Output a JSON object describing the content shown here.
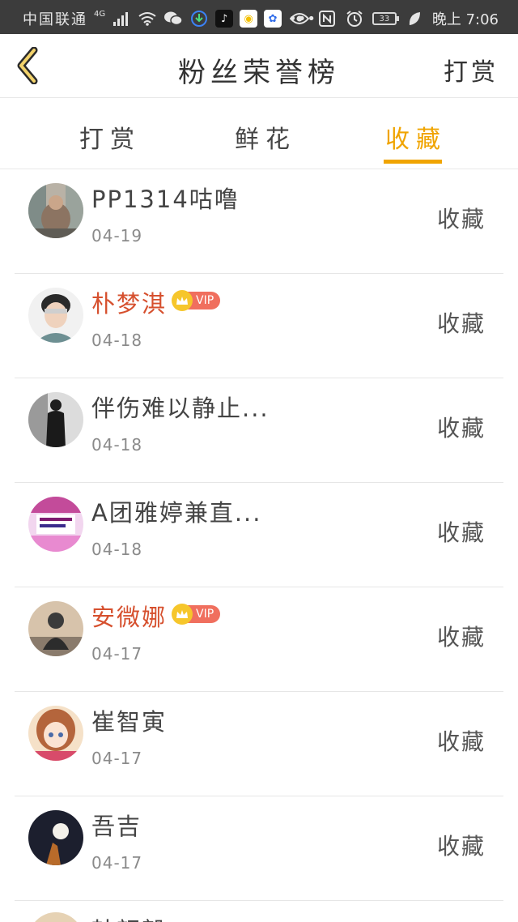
{
  "status_bar": {
    "carrier": "中国联通",
    "network": "4G",
    "time": "晚上 7:06",
    "battery": "33"
  },
  "header": {
    "title": "粉丝荣誉榜",
    "action_label": "打赏"
  },
  "tabs": [
    {
      "label": "打赏",
      "active": false
    },
    {
      "label": "鲜花",
      "active": false
    },
    {
      "label": "收藏",
      "active": true
    }
  ],
  "accent_color": "#f0a400",
  "vip_name_color": "#d6502e",
  "vip_badge_label": "VIP",
  "list": [
    {
      "name": "PP1314咕噜",
      "date": "04-19",
      "vip": false,
      "action": "收藏"
    },
    {
      "name": "朴梦淇",
      "date": "04-18",
      "vip": true,
      "action": "收藏"
    },
    {
      "name": "伴伤难以静止...",
      "date": "04-18",
      "vip": false,
      "action": "收藏"
    },
    {
      "name": "A团雅婷兼直...",
      "date": "04-18",
      "vip": false,
      "action": "收藏"
    },
    {
      "name": "安微娜",
      "date": "04-17",
      "vip": true,
      "action": "收藏"
    },
    {
      "name": "崔智寅",
      "date": "04-17",
      "vip": false,
      "action": "收藏"
    },
    {
      "name": "吾吉",
      "date": "04-17",
      "vip": false,
      "action": "收藏"
    }
  ],
  "partial_item": {
    "name": "韩韶毅"
  }
}
